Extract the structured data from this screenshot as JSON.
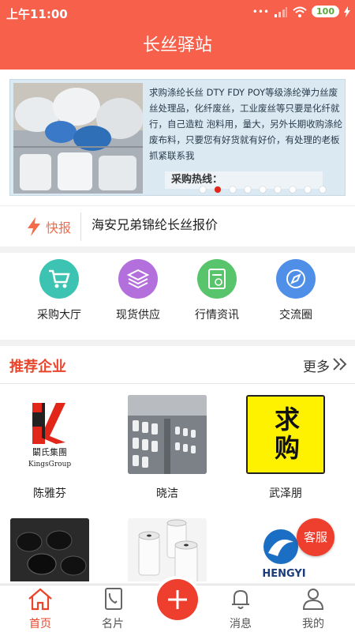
{
  "status": {
    "time": "上午11:00",
    "battery": "100"
  },
  "app": {
    "title": "长丝驿站"
  },
  "banner": {
    "text": "求购涤纶长丝 DTY FDY POY等级涤纶弹力丝废丝处理品，化纤废丝，工业废丝等只要是化纤就行，自己造粒 泡料用，量大，另外长期收购涤纶废布料，只要您有好货就有好价，有处理的老板抓紧联系我",
    "hotline": "采购热线：",
    "active_dot": 1,
    "dot_count": 9
  },
  "news": {
    "tag": "快报",
    "headline": "海安兄弟锦纶长丝报价"
  },
  "menu": [
    {
      "label": "采购大厅",
      "icon": "cart-icon",
      "color": "#3cc3b1"
    },
    {
      "label": "现货供应",
      "icon": "layers-icon",
      "color": "#b36fdc"
    },
    {
      "label": "行情资讯",
      "icon": "document-icon",
      "color": "#58c46b"
    },
    {
      "label": "交流圈",
      "icon": "compass-icon",
      "color": "#4f8fe8"
    }
  ],
  "recommend": {
    "title": "推荐企业",
    "more": "更多",
    "companies": [
      {
        "name": "陈雅芬",
        "logo_text": "闞氏集團",
        "logo_sub": "KingsGroup"
      },
      {
        "name": "晓洁"
      },
      {
        "name": "武泽朋",
        "logo_text": "求购"
      },
      {
        "name": ""
      },
      {
        "name": ""
      },
      {
        "name": "",
        "logo_text": "HENGYI"
      }
    ]
  },
  "float_service": "客服",
  "tabs": [
    {
      "label": "首页",
      "icon": "home-icon",
      "active": true
    },
    {
      "label": "名片",
      "icon": "card-icon",
      "active": false
    },
    {
      "label": "消息",
      "icon": "bell-icon",
      "active": false
    },
    {
      "label": "我的",
      "icon": "user-icon",
      "active": false
    }
  ]
}
